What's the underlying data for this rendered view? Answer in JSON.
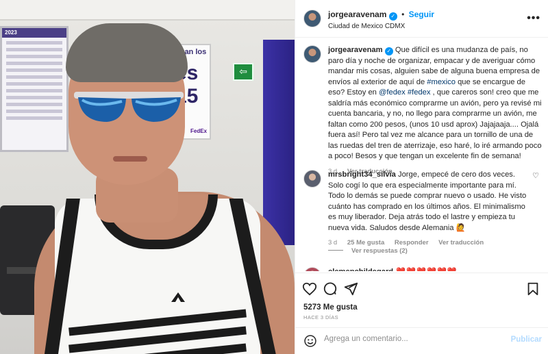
{
  "post": {
    "author": "jorgearavenam",
    "follow_label": "Seguir",
    "location": "Ciudad de Mexico CDMX",
    "more_label": "•••"
  },
  "photo": {
    "board_header": "2023",
    "poster_text": "nuan los",
    "poster_big": "es 15",
    "poster_brand": "FedEx",
    "exit_glyph": "⇦",
    "shirt_logo": "quiksilver-icon"
  },
  "caption": {
    "author": "jorgearavenam",
    "text_1": " Que difícil es una mudanza de país, no paro día y noche de organizar, empacar y de averiguar cómo mandar mis cosas, alguien sabe de alguna buena empresa de envíos al exterior de aquí de ",
    "tag_mexico": "#mexico",
    "text_2": " que se encargue de eso? Estoy en ",
    "tag_fedex_user": "@fedex",
    "text_3": " ",
    "tag_fedex": "#fedex",
    "text_4": " , que careros son! creo que me saldría más económico comprarme un avión, pero ya revisé mi cuenta bancaria, y no, no llego para comprarme un avión, me faltan como 200 pesos, (unos 10 usd aprox) Jajajaaja.... Ojalá fuera así! Pero tal vez me alcance para un tornillo de una de las ruedas del tren de aterrizaje, eso haré, lo iré armando poco a poco! Besos y que tengan un excelente fin de semana!",
    "time": "3 d",
    "translate": "Ver traducción"
  },
  "comments": [
    {
      "author": "mrsbright34_silvia",
      "text": " Jorge, empecé de cero dos veces. Solo cogí lo que era especialmente importante para mí. Todo lo demás se puede comprar nuevo o usado. He visto cuánto has comprado en los últimos años. El minimalismo es muy liberador. Deja atrás todo el lastre y empieza tu nueva vida. Saludos desde Alemania 🙋",
      "time": "3 d",
      "likes": "25 Me gusta",
      "reply": "Responder",
      "translate": "Ver traducción",
      "view_replies": "Ver respuestas (2)"
    },
    {
      "author": "clemenchildegard",
      "text": " ❤️❤️❤️❤️❤️❤️"
    }
  ],
  "actions": {
    "likes": "5273 Me gusta",
    "ago": "HACE 3 DÍAS"
  },
  "composer": {
    "placeholder": "Agrega un comentario...",
    "publish": "Publicar"
  },
  "colors": {
    "accent": "#0095f6",
    "link": "#00376b",
    "muted": "#8e8e8e"
  }
}
